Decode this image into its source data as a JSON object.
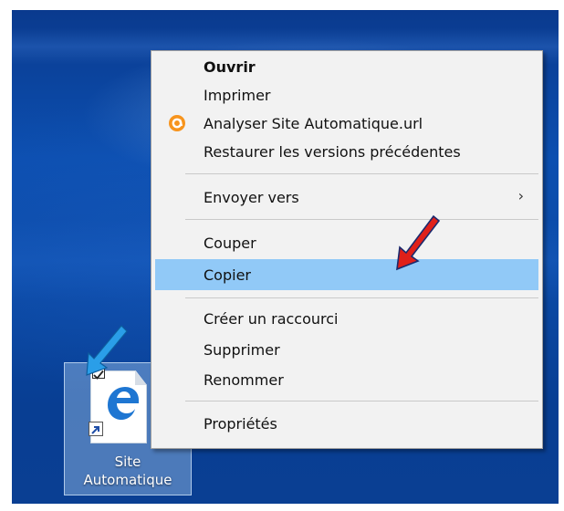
{
  "desktop_icon": {
    "label_line1": "Site",
    "label_line2": "Automatique"
  },
  "context_menu": {
    "items": [
      {
        "label": "Ouvrir"
      },
      {
        "label": "Imprimer"
      },
      {
        "label": "Analyser Site Automatique.url",
        "icon": "avast-icon"
      },
      {
        "label": "Restaurer les versions précédentes"
      },
      {
        "label": "Envoyer vers",
        "chevron": "›"
      },
      {
        "label": "Couper"
      },
      {
        "label": "Copier"
      },
      {
        "label": "Créer un raccourci"
      },
      {
        "label": "Supprimer"
      },
      {
        "label": "Renommer"
      },
      {
        "label": "Propriétés"
      }
    ],
    "highlighted": "Copier"
  },
  "colors": {
    "highlight": "#91c9f7",
    "menu_background": "#f2f2f2",
    "desktop_blue": "#0c4fb0",
    "annotation_red": "#e0201a",
    "annotation_blue": "#2a9ee8",
    "avast_orange": "#f7941d"
  }
}
